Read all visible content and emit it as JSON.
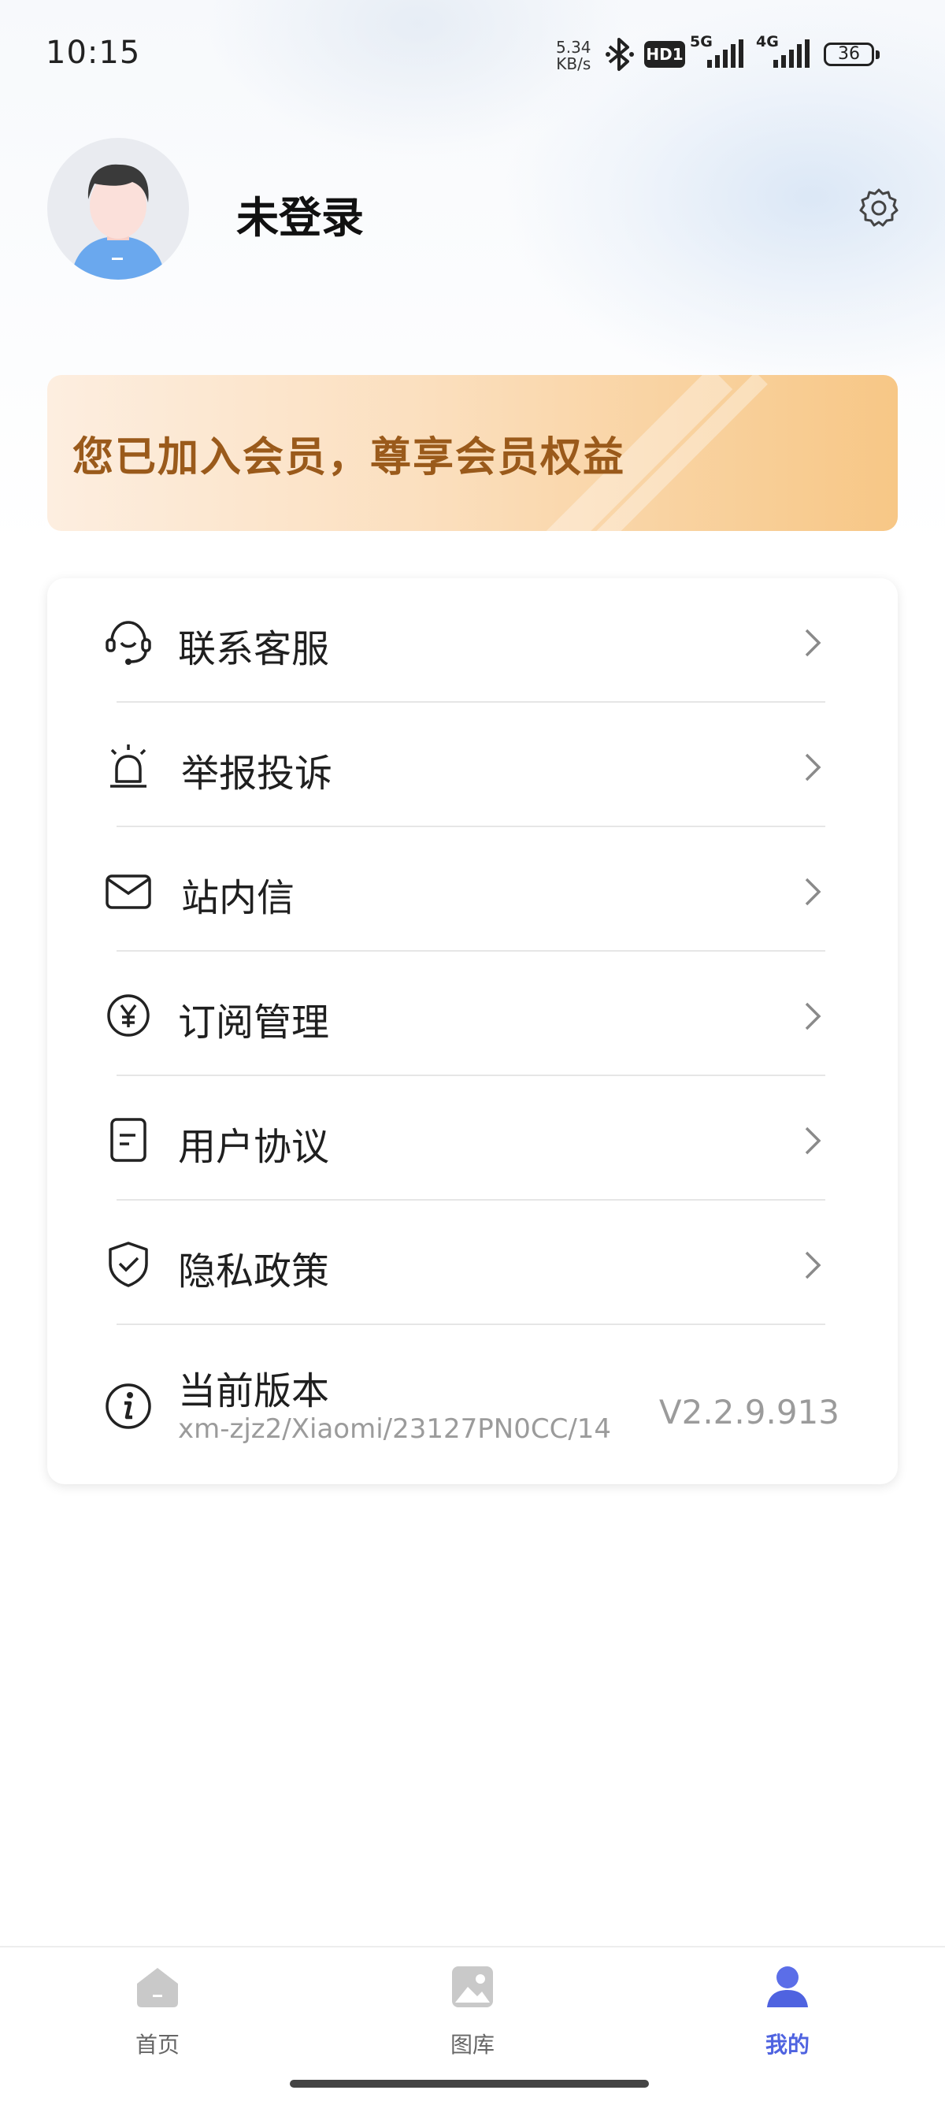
{
  "status_bar": {
    "time": "10:15",
    "net_speed_value": "5.34",
    "net_speed_unit": "KB/s",
    "hd_badge": "HD1",
    "network_1": "5G",
    "network_2": "4G",
    "battery_level": "36"
  },
  "profile": {
    "username": "未登录"
  },
  "banner": {
    "text": "您已加入会员，尊享会员权益"
  },
  "menu": {
    "items": [
      {
        "label": "联系客服",
        "icon": "headset-icon"
      },
      {
        "label": "举报投诉",
        "icon": "alarm-icon"
      },
      {
        "label": "站内信",
        "icon": "mail-icon"
      },
      {
        "label": "订阅管理",
        "icon": "yen-circle-icon"
      },
      {
        "label": "用户协议",
        "icon": "document-icon"
      },
      {
        "label": "隐私政策",
        "icon": "shield-check-icon"
      }
    ],
    "version": {
      "label": "当前版本",
      "sub": "xm-zjz2/Xiaomi/23127PN0CC/14",
      "value": "V2.2.9.913"
    }
  },
  "bottom_nav": {
    "items": [
      {
        "label": "首页",
        "icon": "home-icon",
        "active": false
      },
      {
        "label": "图库",
        "icon": "gallery-icon",
        "active": false
      },
      {
        "label": "我的",
        "icon": "user-icon",
        "active": true
      }
    ]
  },
  "colors": {
    "accent": "#4f63e0",
    "banner_text": "#9a5a1b",
    "muted_text": "#9b9b9b"
  }
}
